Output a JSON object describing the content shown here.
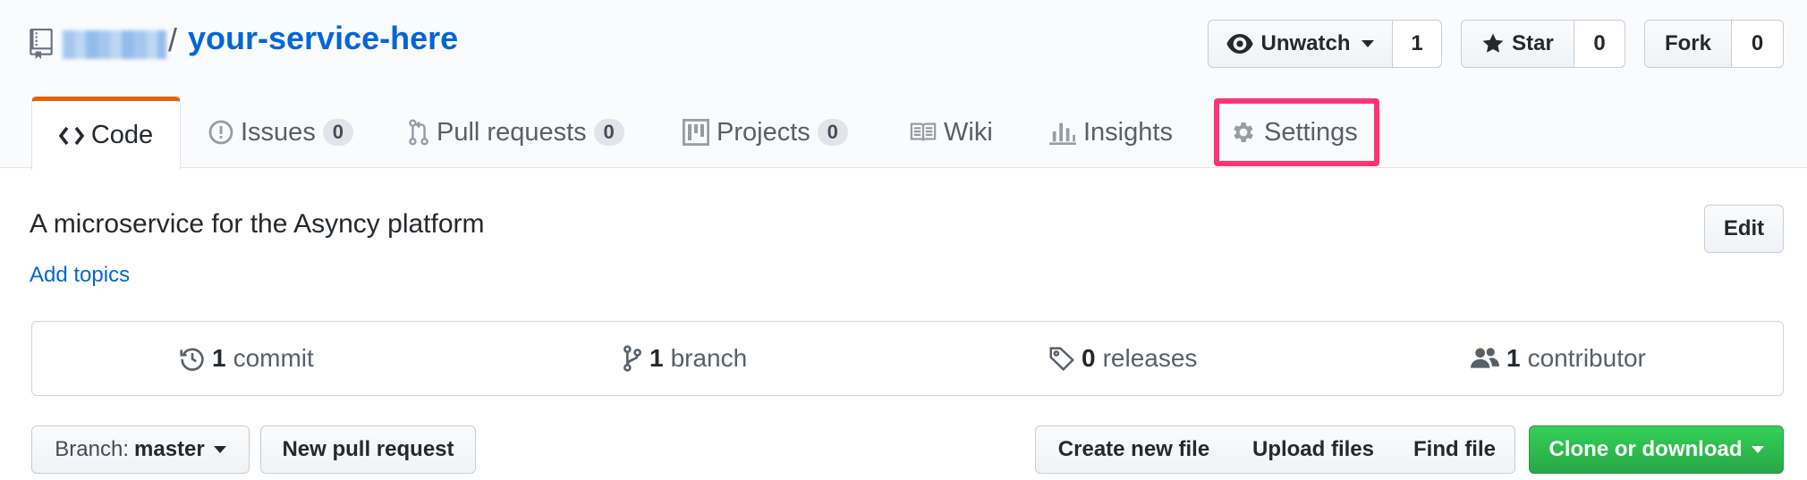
{
  "repo": {
    "separator": "/",
    "name": "your-service-here"
  },
  "actions": {
    "watch_label": "Unwatch",
    "watch_count": "1",
    "star_label": "Star",
    "star_count": "0",
    "fork_label": "Fork",
    "fork_count": "0"
  },
  "tabs": [
    {
      "label": "Code",
      "count": null,
      "selected": true
    },
    {
      "label": "Issues",
      "count": "0"
    },
    {
      "label": "Pull requests",
      "count": "0"
    },
    {
      "label": "Projects",
      "count": "0"
    },
    {
      "label": "Wiki",
      "count": null
    },
    {
      "label": "Insights",
      "count": null
    },
    {
      "label": "Settings",
      "count": null,
      "highlighted": true
    }
  ],
  "description": {
    "text": "A microservice for the Asyncy platform",
    "add_topics": "Add topics",
    "edit_label": "Edit"
  },
  "summary": {
    "commits_num": "1",
    "commits_label": "commit",
    "branches_num": "1",
    "branches_label": "branch",
    "releases_num": "0",
    "releases_label": "releases",
    "contributors_num": "1",
    "contributors_label": "contributor"
  },
  "file_nav": {
    "branch_prefix": "Branch:",
    "branch_name": "master",
    "new_pr": "New pull request",
    "create_file": "Create new file",
    "upload_files": "Upload files",
    "find_file": "Find file",
    "clone": "Clone or download"
  },
  "colors": {
    "link": "#0366d6",
    "selected_tab_accent": "#e36209",
    "highlight_box": "#fb3672",
    "clone_button": "#28a745"
  }
}
